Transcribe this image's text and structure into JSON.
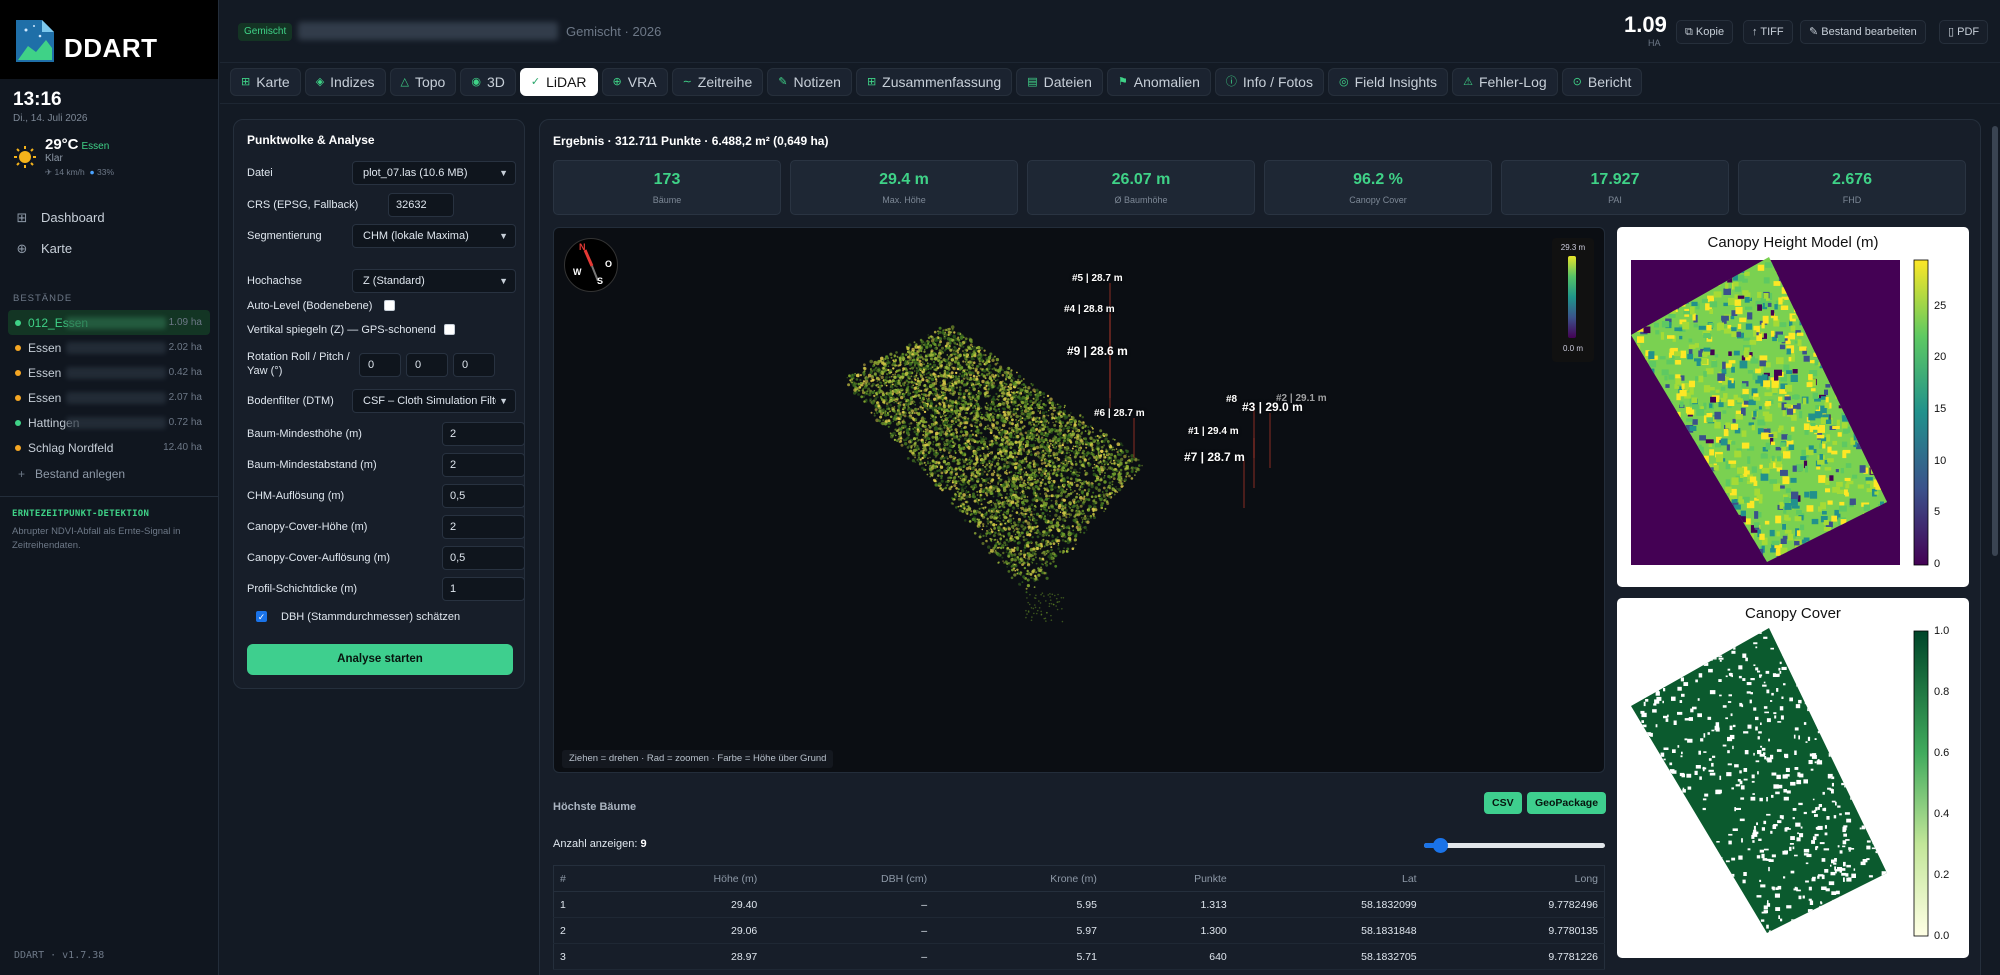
{
  "app": {
    "name": "DDART",
    "version": "DDART · v1.7.38"
  },
  "clock": {
    "time": "13:16",
    "date": "Di., 14. Juli 2026"
  },
  "weather": {
    "temp": "29°C",
    "city": "Essen",
    "condition": "Klar",
    "wind": "14 km/h",
    "humidity": "33%",
    "icon": "sun-icon"
  },
  "nav": [
    {
      "label": "Dashboard",
      "icon": "grid-icon"
    },
    {
      "label": "Karte",
      "icon": "globe-icon"
    }
  ],
  "stands_title": "BESTÄNDE",
  "stands": [
    {
      "name": "012_Essen",
      "ha": "1.09 ha",
      "color": "#3fd287",
      "active": true
    },
    {
      "name": "Essen",
      "ha": "2.02 ha",
      "color": "#f5a623",
      "active": false
    },
    {
      "name": "Essen",
      "ha": "0.42 ha",
      "color": "#f5a623",
      "active": false
    },
    {
      "name": "Essen",
      "ha": "2.07 ha",
      "color": "#f5a623",
      "active": false
    },
    {
      "name": "Hattingen",
      "ha": "0.72 ha",
      "color": "#3fd287",
      "active": false
    },
    {
      "name": "Schlag Nordfeld",
      "ha": "12.40 ha",
      "color": "#f5a623",
      "active": false
    }
  ],
  "add_stand": "Bestand anlegen",
  "harvest": {
    "title": "ERNTEZEITPUNKT-DETEKTION",
    "text": "Abrupter NDVI-Abfall als Ernte-Signal in Zeitreihendaten."
  },
  "header": {
    "badge": "Gemischt",
    "subtitle": "Gemischt · 2026",
    "area": "1.09",
    "area_unit": "HA",
    "buttons": [
      {
        "label": "Kopie",
        "icon": "copy-icon"
      },
      {
        "label": "TIFF",
        "icon": "download-icon"
      },
      {
        "label": "Bestand bearbeiten",
        "icon": "pencil-icon"
      },
      {
        "label": "PDF",
        "icon": "file-icon"
      }
    ]
  },
  "tabs": [
    {
      "label": "Karte",
      "icon": "grid-icon"
    },
    {
      "label": "Indizes",
      "icon": "diamond-icon"
    },
    {
      "label": "Topo",
      "icon": "triangle-icon"
    },
    {
      "label": "3D",
      "icon": "cube-icon"
    },
    {
      "label": "LiDAR",
      "icon": "check-icon",
      "active": true
    },
    {
      "label": "VRA",
      "icon": "globe-icon"
    },
    {
      "label": "Zeitreihe",
      "icon": "wave-icon"
    },
    {
      "label": "Notizen",
      "icon": "pen-icon"
    },
    {
      "label": "Zusammenfassung",
      "icon": "grid-icon"
    },
    {
      "label": "Dateien",
      "icon": "folder-icon"
    },
    {
      "label": "Anomalien",
      "icon": "flag-icon"
    },
    {
      "label": "Info / Fotos",
      "icon": "info-icon"
    },
    {
      "label": "Field Insights",
      "icon": "target-icon"
    },
    {
      "label": "Fehler-Log",
      "icon": "warning-icon"
    },
    {
      "label": "Bericht",
      "icon": "lock-icon"
    }
  ],
  "panel": {
    "title": "Punktwolke & Analyse",
    "file_label": "Datei",
    "file_value": "plot_07.las (10.6 MB)",
    "crs_label": "CRS (EPSG, Fallback)",
    "crs_value": "32632",
    "seg_label": "Segmentierung",
    "seg_value": "CHM (lokale Maxima)",
    "axis_label": "Hochachse",
    "axis_value": "Z (Standard)",
    "autolevel_label": "Auto-Level (Bodenebene)",
    "flip_label": "Vertikal spiegeln (Z) — GPS-schonend",
    "rot_label": "Rotation Roll / Pitch / Yaw (°)",
    "rot_values": [
      "0",
      "0",
      "0"
    ],
    "ground_label": "Bodenfilter (DTM)",
    "ground_value": "CSF – Cloth Simulation Filter",
    "min_height_label": "Baum-Mindesthöhe (m)",
    "min_height": "2",
    "min_dist_label": "Baum-Mindestabstand (m)",
    "min_dist": "2",
    "chm_res_label": "CHM-Auflösung (m)",
    "chm_res": "0,5",
    "cc_height_label": "Canopy-Cover-Höhe (m)",
    "cc_height": "2",
    "cc_res_label": "Canopy-Cover-Auflösung (m)",
    "cc_res": "0,5",
    "profile_label": "Profil-Schichtdicke (m)",
    "profile": "1",
    "dbh_label": "DBH (Stammdurchmesser) schätzen",
    "run": "Analyse starten"
  },
  "result": {
    "title": "Ergebnis · 312.711 Punkte · 6.488,2 m² (0,649 ha)",
    "stats": [
      {
        "value": "173",
        "label": "Bäume"
      },
      {
        "value": "29.4 m",
        "label": "Max. Höhe"
      },
      {
        "value": "26.07 m",
        "label": "Ø Baumhöhe"
      },
      {
        "value": "96.2 %",
        "label": "Canopy Cover"
      },
      {
        "value": "17.927",
        "label": "PAI"
      },
      {
        "value": "2.676",
        "label": "FHD"
      }
    ],
    "scale_max": "29.3 m",
    "scale_min": "0.0 m",
    "hint": "Ziehen = drehen · Rad = zoomen · Farbe = Höhe über Grund",
    "compass": {
      "n": "N",
      "o": "O",
      "s": "S",
      "w": "W"
    },
    "tree_labels": [
      "#5 | 28.7 m",
      "#4 | 28.8 m",
      "#9 | 28.6 m",
      "#6 | 28.7 m",
      "#8",
      "#2 | 29.1 m",
      "#3 | 29.0 m",
      "#1 | 29.4 m",
      "#7 | 28.7 m"
    ],
    "chm": {
      "title": "Canopy Height Model (m)",
      "ticks": [
        "25",
        "20",
        "15",
        "10",
        "5",
        "0"
      ]
    },
    "cc": {
      "title": "Canopy Cover",
      "ticks": [
        "1.0",
        "0.8",
        "0.6",
        "0.4",
        "0.2",
        "0.0"
      ]
    },
    "top_trees": "Höchste Bäume",
    "csv": "CSV",
    "gpkg": "GeoPackage",
    "count_label": "Anzahl anzeigen:",
    "count_value": "9",
    "count_fraction": 0.05,
    "table": {
      "headers": [
        "#",
        "Höhe (m)",
        "DBH (cm)",
        "Krone (m)",
        "Punkte",
        "Lat",
        "Long"
      ],
      "rows": [
        [
          "1",
          "29.40",
          "–",
          "5.95",
          "1.313",
          "58.1832099",
          "9.7782496"
        ],
        [
          "2",
          "29.06",
          "–",
          "5.97",
          "1.300",
          "58.1831848",
          "9.7780135"
        ],
        [
          "3",
          "28.97",
          "–",
          "5.71",
          "640",
          "58.1832705",
          "9.7781226"
        ]
      ]
    }
  }
}
